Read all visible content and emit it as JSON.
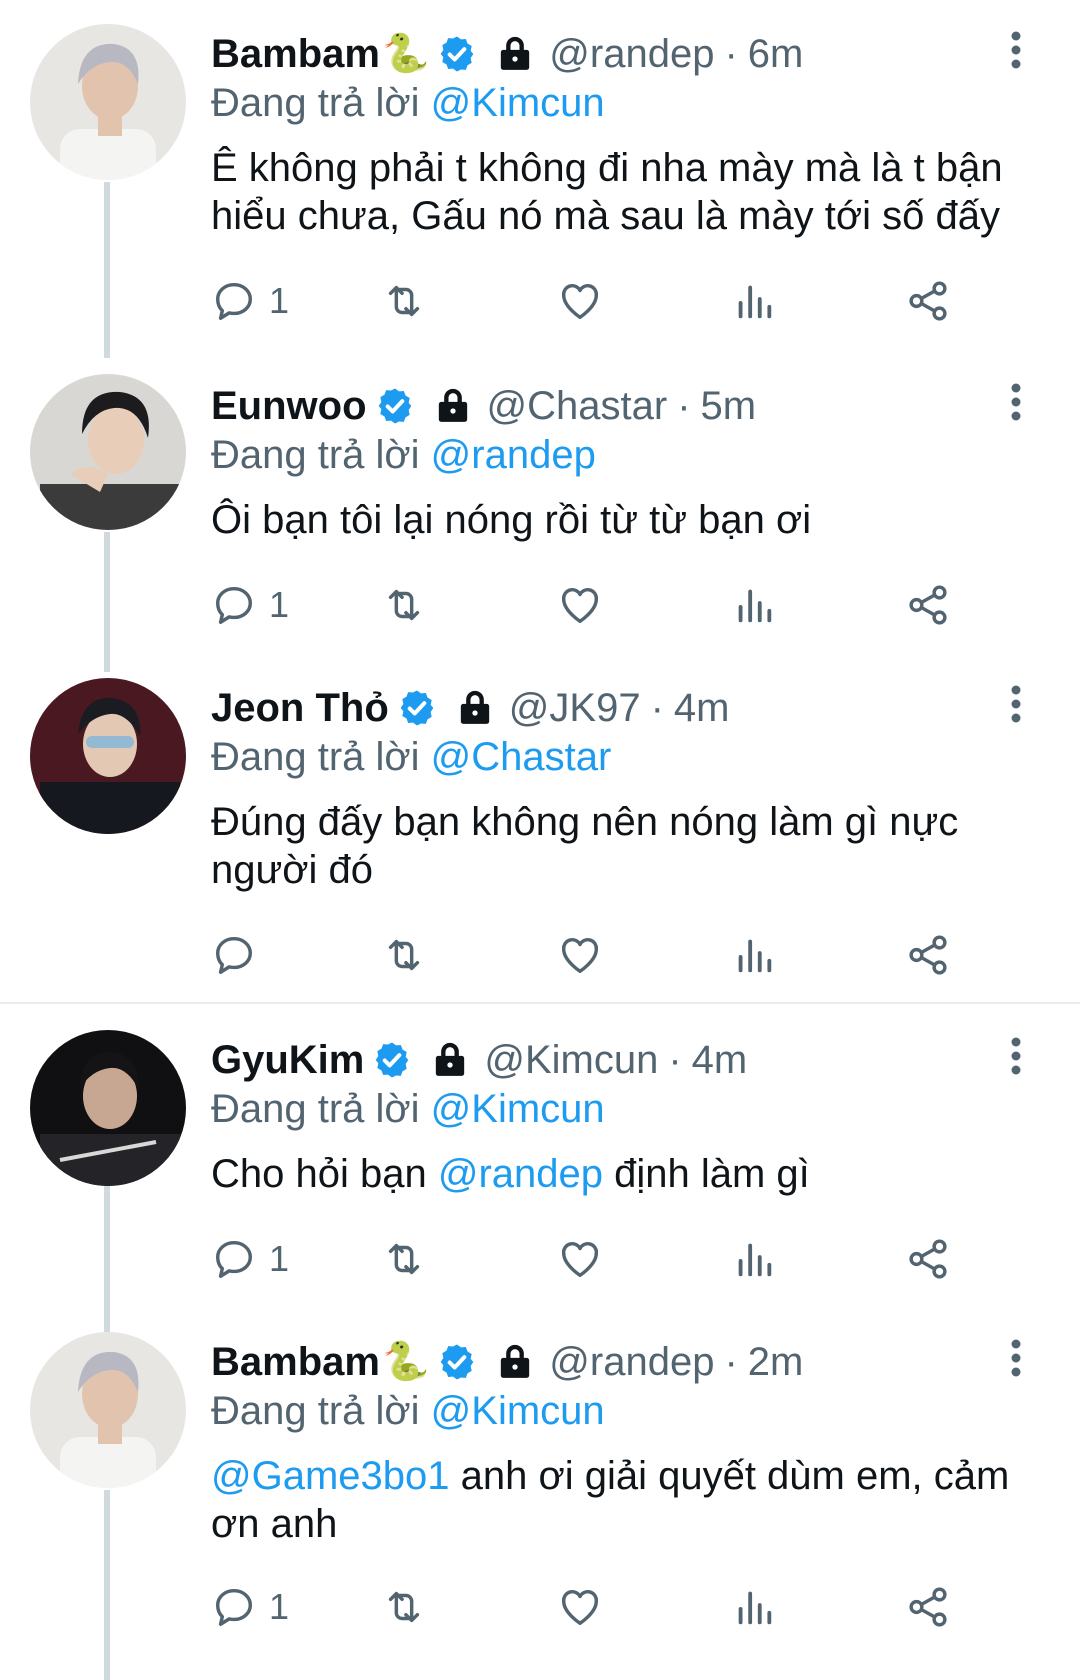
{
  "tweets": [
    {
      "name": "Bambam",
      "emoji": "🐍",
      "handle": "@randep",
      "time": "6m",
      "replying_prefix": "Đang trả lời",
      "replying_to": "@Kimcun",
      "body_mention": "",
      "body": "Ê không phải t không đi nha mày mà là t bận hiểu chưa, Gấu nó mà sau là mày tới số đấy",
      "body_suffix": "",
      "reply_count": "1",
      "avatar": "light-haired-man-white-tee"
    },
    {
      "name": "Eunwoo",
      "emoji": "",
      "handle": "@Chastar",
      "time": "5m",
      "replying_prefix": "Đang trả lời",
      "replying_to": "@randep",
      "body_mention": "",
      "body": "Ôi bạn tôi lại nóng rồi từ từ bạn ơi",
      "body_suffix": "",
      "reply_count": "1",
      "avatar": "dark-haired-man-plaid"
    },
    {
      "name": "Jeon Thỏ",
      "emoji": "",
      "handle": "@JK97",
      "time": "4m",
      "replying_prefix": "Đang trả lời",
      "replying_to": "@Chastar",
      "body_mention": "",
      "body": "Đúng đấy bạn không nên nóng làm gì nực người đó",
      "body_suffix": "",
      "reply_count": "",
      "avatar": "man-sunglasses-stage"
    },
    {
      "name": "GyuKim",
      "emoji": "",
      "handle": "@Kimcun",
      "time": "4m",
      "replying_prefix": "Đang trả lời",
      "replying_to": "@Kimcun",
      "body_mention": "",
      "body": "Cho hỏi bạn ",
      "body_inline_mention": "@randep",
      "body_suffix": " định làm gì",
      "reply_count": "1",
      "avatar": "man-dark-jacket"
    },
    {
      "name": "Bambam",
      "emoji": "🐍",
      "handle": "@randep",
      "time": "2m",
      "replying_prefix": "Đang trả lời",
      "replying_to": "@Kimcun",
      "body_mention": "@Game3bo1",
      "body": " anh ơi giải quyết dùm em, cảm ơn anh",
      "body_suffix": "",
      "reply_count": "1",
      "avatar": "light-haired-man-white-tee"
    }
  ],
  "icons": {
    "verified": "verified-badge-icon",
    "lock": "protected-lock-icon",
    "more": "more-vertical-icon",
    "reply": "reply-icon",
    "retweet": "retweet-icon",
    "like": "heart-icon",
    "views": "views-bar-icon",
    "share": "share-icon"
  },
  "colors": {
    "accent": "#1d9bf0",
    "muted": "#536471",
    "thread_line": "#cfd9de",
    "text": "#0f1419"
  }
}
